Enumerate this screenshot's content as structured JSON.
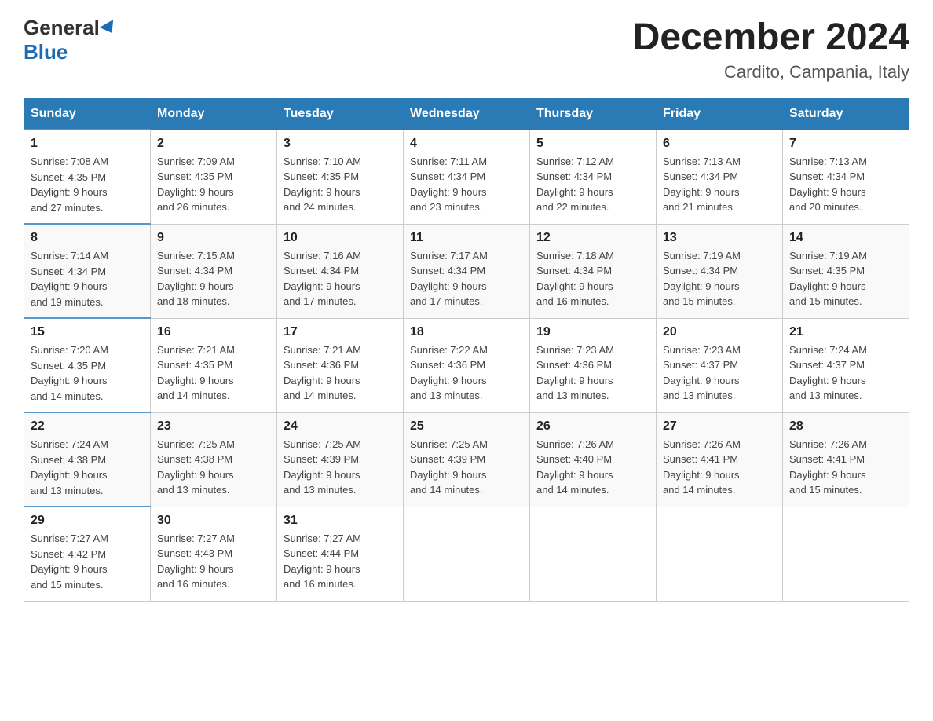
{
  "logo": {
    "general": "General",
    "blue": "Blue"
  },
  "title": "December 2024",
  "location": "Cardito, Campania, Italy",
  "days_of_week": [
    "Sunday",
    "Monday",
    "Tuesday",
    "Wednesday",
    "Thursday",
    "Friday",
    "Saturday"
  ],
  "weeks": [
    [
      {
        "day": "1",
        "sunrise": "7:08 AM",
        "sunset": "4:35 PM",
        "daylight": "9 hours and 27 minutes."
      },
      {
        "day": "2",
        "sunrise": "7:09 AM",
        "sunset": "4:35 PM",
        "daylight": "9 hours and 26 minutes."
      },
      {
        "day": "3",
        "sunrise": "7:10 AM",
        "sunset": "4:35 PM",
        "daylight": "9 hours and 24 minutes."
      },
      {
        "day": "4",
        "sunrise": "7:11 AM",
        "sunset": "4:34 PM",
        "daylight": "9 hours and 23 minutes."
      },
      {
        "day": "5",
        "sunrise": "7:12 AM",
        "sunset": "4:34 PM",
        "daylight": "9 hours and 22 minutes."
      },
      {
        "day": "6",
        "sunrise": "7:13 AM",
        "sunset": "4:34 PM",
        "daylight": "9 hours and 21 minutes."
      },
      {
        "day": "7",
        "sunrise": "7:13 AM",
        "sunset": "4:34 PM",
        "daylight": "9 hours and 20 minutes."
      }
    ],
    [
      {
        "day": "8",
        "sunrise": "7:14 AM",
        "sunset": "4:34 PM",
        "daylight": "9 hours and 19 minutes."
      },
      {
        "day": "9",
        "sunrise": "7:15 AM",
        "sunset": "4:34 PM",
        "daylight": "9 hours and 18 minutes."
      },
      {
        "day": "10",
        "sunrise": "7:16 AM",
        "sunset": "4:34 PM",
        "daylight": "9 hours and 17 minutes."
      },
      {
        "day": "11",
        "sunrise": "7:17 AM",
        "sunset": "4:34 PM",
        "daylight": "9 hours and 17 minutes."
      },
      {
        "day": "12",
        "sunrise": "7:18 AM",
        "sunset": "4:34 PM",
        "daylight": "9 hours and 16 minutes."
      },
      {
        "day": "13",
        "sunrise": "7:19 AM",
        "sunset": "4:34 PM",
        "daylight": "9 hours and 15 minutes."
      },
      {
        "day": "14",
        "sunrise": "7:19 AM",
        "sunset": "4:35 PM",
        "daylight": "9 hours and 15 minutes."
      }
    ],
    [
      {
        "day": "15",
        "sunrise": "7:20 AM",
        "sunset": "4:35 PM",
        "daylight": "9 hours and 14 minutes."
      },
      {
        "day": "16",
        "sunrise": "7:21 AM",
        "sunset": "4:35 PM",
        "daylight": "9 hours and 14 minutes."
      },
      {
        "day": "17",
        "sunrise": "7:21 AM",
        "sunset": "4:36 PM",
        "daylight": "9 hours and 14 minutes."
      },
      {
        "day": "18",
        "sunrise": "7:22 AM",
        "sunset": "4:36 PM",
        "daylight": "9 hours and 13 minutes."
      },
      {
        "day": "19",
        "sunrise": "7:23 AM",
        "sunset": "4:36 PM",
        "daylight": "9 hours and 13 minutes."
      },
      {
        "day": "20",
        "sunrise": "7:23 AM",
        "sunset": "4:37 PM",
        "daylight": "9 hours and 13 minutes."
      },
      {
        "day": "21",
        "sunrise": "7:24 AM",
        "sunset": "4:37 PM",
        "daylight": "9 hours and 13 minutes."
      }
    ],
    [
      {
        "day": "22",
        "sunrise": "7:24 AM",
        "sunset": "4:38 PM",
        "daylight": "9 hours and 13 minutes."
      },
      {
        "day": "23",
        "sunrise": "7:25 AM",
        "sunset": "4:38 PM",
        "daylight": "9 hours and 13 minutes."
      },
      {
        "day": "24",
        "sunrise": "7:25 AM",
        "sunset": "4:39 PM",
        "daylight": "9 hours and 13 minutes."
      },
      {
        "day": "25",
        "sunrise": "7:25 AM",
        "sunset": "4:39 PM",
        "daylight": "9 hours and 14 minutes."
      },
      {
        "day": "26",
        "sunrise": "7:26 AM",
        "sunset": "4:40 PM",
        "daylight": "9 hours and 14 minutes."
      },
      {
        "day": "27",
        "sunrise": "7:26 AM",
        "sunset": "4:41 PM",
        "daylight": "9 hours and 14 minutes."
      },
      {
        "day": "28",
        "sunrise": "7:26 AM",
        "sunset": "4:41 PM",
        "daylight": "9 hours and 15 minutes."
      }
    ],
    [
      {
        "day": "29",
        "sunrise": "7:27 AM",
        "sunset": "4:42 PM",
        "daylight": "9 hours and 15 minutes."
      },
      {
        "day": "30",
        "sunrise": "7:27 AM",
        "sunset": "4:43 PM",
        "daylight": "9 hours and 16 minutes."
      },
      {
        "day": "31",
        "sunrise": "7:27 AM",
        "sunset": "4:44 PM",
        "daylight": "9 hours and 16 minutes."
      },
      null,
      null,
      null,
      null
    ]
  ],
  "labels": {
    "sunrise": "Sunrise:",
    "sunset": "Sunset:",
    "daylight": "Daylight:"
  }
}
